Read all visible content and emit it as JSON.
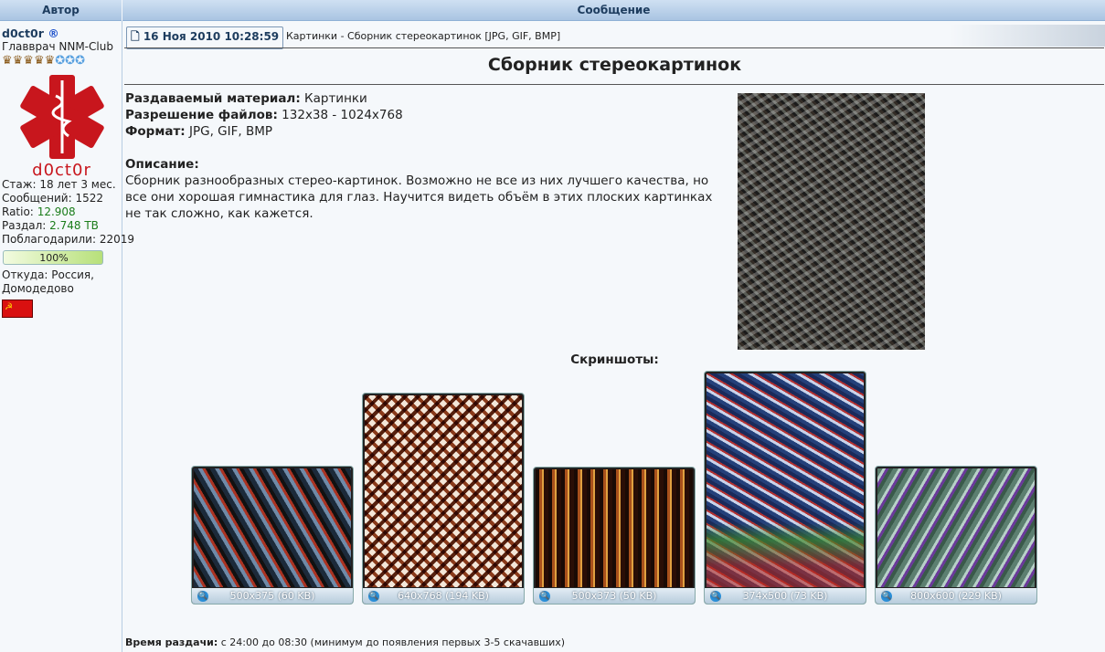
{
  "header": {
    "author_col": "Автор",
    "message_col": "Сообщение"
  },
  "author": {
    "name": "d0ct0r",
    "reg_mark": "®",
    "rank": "Главврач NNM-Club",
    "avatar_text": "d0ct0r",
    "experience": "Стаж: 18 лет 3 мес.",
    "posts": "Сообщений: 1522",
    "ratio_label": "Ratio:",
    "ratio": "12.908",
    "upload_label": "Раздал:",
    "upload": "2.748 TB",
    "thanks": "Поблагодарили: 22019",
    "progress_label": "100%",
    "progress": 100,
    "location": "Откуда: Россия, Домодедово"
  },
  "post": {
    "date": "16 Ноя 2010 10:28:59",
    "subject": "Картинки - Сборник стереокартинок [JPG, GIF, BMP]",
    "title": "Сборник стереокартинок",
    "fields": [
      {
        "label": "Раздаваемый материал:",
        "value": "Картинки"
      },
      {
        "label": "Разрешение файлов:",
        "value": "132x38 - 1024x768"
      },
      {
        "label": "Формат:",
        "value": "JPG, GIF, BMP"
      }
    ],
    "desc_label": "Описание:",
    "description": "Сборник разнообразных стерео-картинок. Возможно не все из них лучшего качества, но все они хорошая гимнастика для глаз. Научится видеть объём в этих плоских картинках не так сложно, как кажется.",
    "screens_label": "Скриншоты:",
    "screens": [
      {
        "caption": "500x375 (60 KB)"
      },
      {
        "caption": "640x768 (194 KB)"
      },
      {
        "caption": "500x373 (50 KB)"
      },
      {
        "caption": "374x500 (73 KB)"
      },
      {
        "caption": "800x600 (229 KB)"
      }
    ],
    "seed_label": "Время раздачи:",
    "seed_time": "с 24:00 до 08:30 (минимум до появления первых 3-5 скачавших)"
  }
}
